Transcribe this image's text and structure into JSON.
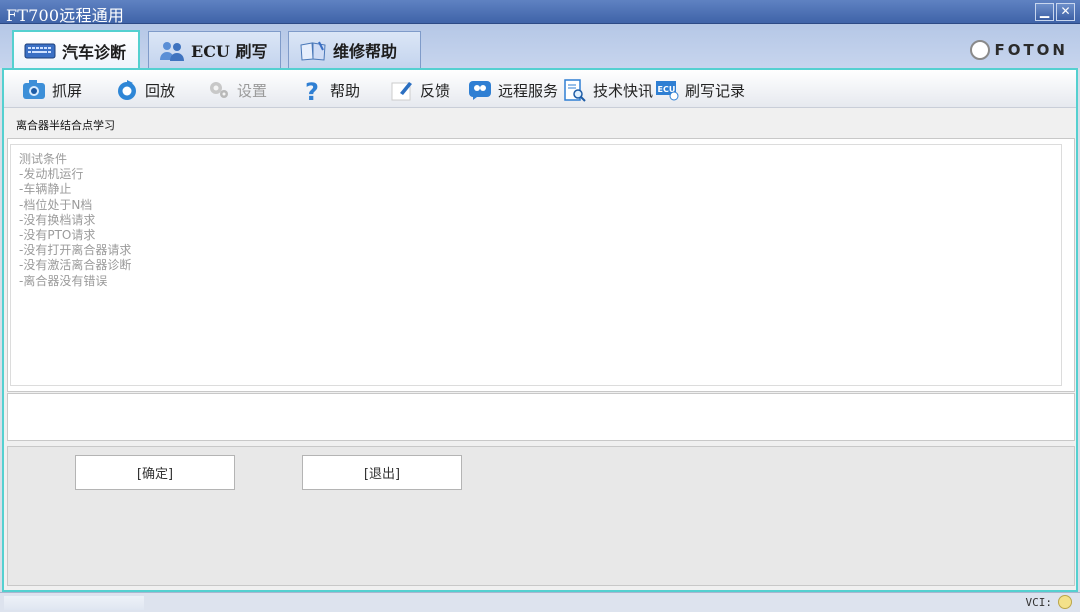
{
  "window": {
    "title": "FT700远程通用"
  },
  "tabs": [
    {
      "label": "汽车诊断",
      "icon": "keyboard-icon",
      "active": true
    },
    {
      "label": "ECU 刷写",
      "icon": "users-icon",
      "active": false
    },
    {
      "label": "维修帮助",
      "icon": "book-icon",
      "active": false
    }
  ],
  "brand": {
    "name": "FOTON",
    "logo": "foton-logo"
  },
  "toolbar": {
    "items": [
      {
        "label": "抓屏",
        "icon": "camera-icon",
        "enabled": true
      },
      {
        "label": "回放",
        "icon": "replay-icon",
        "enabled": true
      },
      {
        "label": "设置",
        "icon": "gear-icon",
        "enabled": false
      },
      {
        "label": "帮助",
        "icon": "question-icon",
        "enabled": true
      },
      {
        "label": "反馈",
        "icon": "pencil-icon",
        "enabled": true
      },
      {
        "label": "远程服务",
        "icon": "remote-service-icon",
        "enabled": true
      },
      {
        "label": "技术快讯",
        "icon": "document-search-icon",
        "enabled": true
      },
      {
        "label": "刷写记录",
        "icon": "ecu-icon",
        "enabled": true
      }
    ]
  },
  "section": {
    "title": "离合器半结合点学习"
  },
  "content": {
    "lines": [
      "测试条件",
      "-发动机运行",
      "-车辆静止",
      "-档位处于N档",
      "-没有换档请求",
      "-没有PTO请求",
      "-没有打开离合器请求",
      "-没有激活离合器诊断",
      "-离合器没有错误"
    ]
  },
  "buttons": {
    "ok": "[确定]",
    "exit": "[退出]"
  },
  "status": {
    "vci_label": "VCI:"
  },
  "colors": {
    "accent": "#54d0d0",
    "titlebar": "#4a6db0"
  }
}
